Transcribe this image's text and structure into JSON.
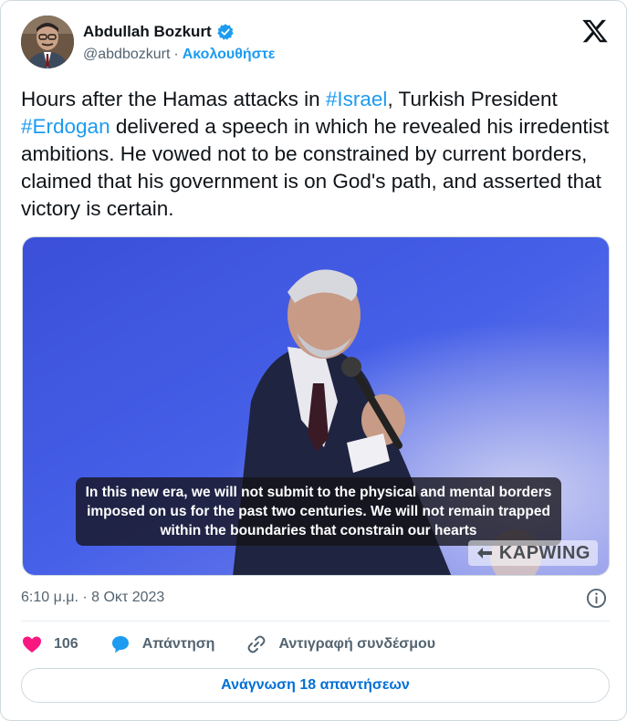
{
  "author": {
    "display_name": "Abdullah Bozkurt",
    "handle": "@abdbozkurt",
    "separator": "·",
    "follow_label": "Ακολουθήστε"
  },
  "tweet": {
    "text_1": "Hours after the Hamas attacks in ",
    "hashtag_1": "#Israel",
    "text_2": ", Turkish President ",
    "hashtag_2": "#Erdogan",
    "text_3": " delivered a speech in which he revealed his irredentist ambitions. He vowed not to be constrained by current borders, claimed that his government is on God's path, and asserted that victory is certain."
  },
  "media": {
    "caption": "In this new era, we will not submit to the physical and mental borders imposed on us for the past two centuries. We will not remain trapped within the boundaries that constrain our hearts",
    "watermark": "KAPWING"
  },
  "meta": {
    "timestamp": "6:10 μ.μ. · 8 Οκτ 2023"
  },
  "actions": {
    "likes": "106",
    "reply_label": "Απάντηση",
    "copy_link_label": "Αντιγραφή συνδέσμου"
  },
  "read_replies_label": "Ανάγνωση 18 απαντήσεων",
  "colors": {
    "accent": "#1d9bf0",
    "like": "#f91880",
    "text": "#0f1419",
    "muted": "#536471"
  },
  "icons": [
    "verified-badge-icon",
    "x-logo-icon",
    "info-icon",
    "heart-icon",
    "reply-bubble-icon",
    "link-icon"
  ]
}
